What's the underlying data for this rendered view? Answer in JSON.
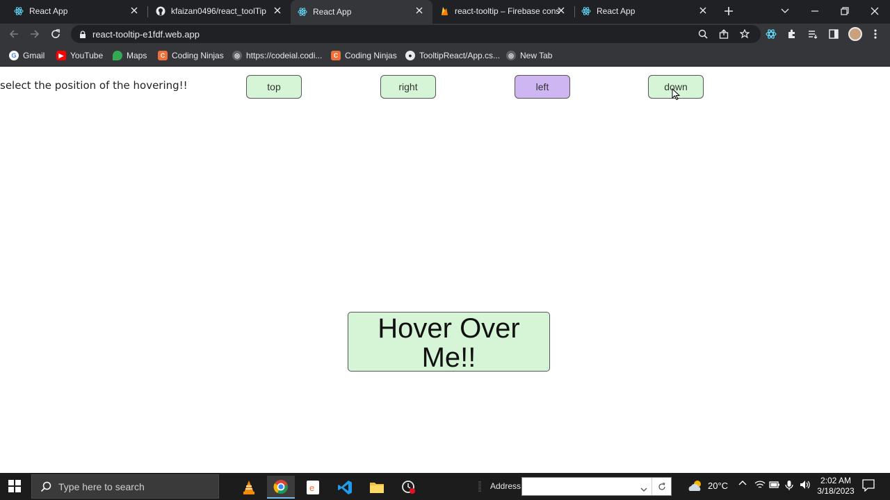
{
  "browser": {
    "tabs": [
      {
        "title": "React App",
        "icon": "react-icon",
        "active": false
      },
      {
        "title": "kfaizan0496/react_toolTip",
        "icon": "github-icon",
        "active": false
      },
      {
        "title": "React App",
        "icon": "react-icon",
        "active": true
      },
      {
        "title": "react-tooltip – Firebase cons",
        "icon": "firebase-icon",
        "active": false
      },
      {
        "title": "React App",
        "icon": "react-icon",
        "active": false
      }
    ],
    "url": "react-tooltip-e1fdf.web.app",
    "bookmarks": [
      {
        "label": "Gmail",
        "icon": "google-icon"
      },
      {
        "label": "YouTube",
        "icon": "youtube-icon"
      },
      {
        "label": "Maps",
        "icon": "maps-icon"
      },
      {
        "label": "Coding Ninjas",
        "icon": "coding-ninjas-icon"
      },
      {
        "label": "https://codeial.codi...",
        "icon": "globe-icon"
      },
      {
        "label": "Coding Ninjas",
        "icon": "coding-ninjas-icon"
      },
      {
        "label": "TooltipReact/App.cs...",
        "icon": "github-icon"
      },
      {
        "label": "New Tab",
        "icon": "globe-icon"
      }
    ]
  },
  "page": {
    "prompt": "select the position of the hovering!!",
    "position_buttons": [
      {
        "label": "top",
        "selected": false
      },
      {
        "label": "right",
        "selected": false
      },
      {
        "label": "left",
        "selected": true
      },
      {
        "label": "down",
        "selected": false
      }
    ],
    "hover_target": "Hover Over Me!!",
    "colors": {
      "button_bg": "#d6f5d6",
      "selected_bg": "#cdb6f2"
    }
  },
  "taskbar": {
    "search_placeholder": "Type here to search",
    "address_label": "Address",
    "weather": "20°C",
    "time": "2:02 AM",
    "date": "3/18/2023"
  }
}
